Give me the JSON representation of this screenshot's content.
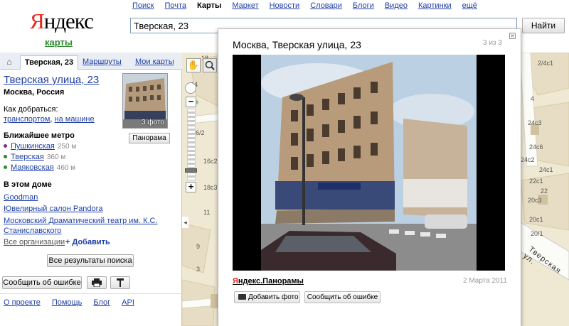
{
  "logo": {
    "first_letter": "Я",
    "rest": "ндекс",
    "service": "карты"
  },
  "topnav": [
    "Поиск",
    "Почта",
    "Карты",
    "Маркет",
    "Новости",
    "Словари",
    "Блоги",
    "Видео",
    "Картинки",
    "ещё"
  ],
  "topnav_active": "Карты",
  "search": {
    "value": "Тверская, 23",
    "button": "Найти"
  },
  "tabs": {
    "address": "Тверская, 23",
    "routes": "Маршруты",
    "my_maps": "Мои карты"
  },
  "place": {
    "title": "Тверская улица, 23",
    "subtitle": "Москва, Россия",
    "howto_label": "Как добраться:",
    "howto_transport": "транспортом",
    "howto_sep": ", ",
    "howto_car": "на машине",
    "photo_count": "3 фото",
    "panorama": "Панорама"
  },
  "metro": {
    "title": "Ближайшее метро",
    "stations": [
      {
        "name": "Пушкинская",
        "dist": "250 м",
        "color": "#8a2a8a"
      },
      {
        "name": "Тверская",
        "dist": "360 м",
        "color": "#2b8a2b"
      },
      {
        "name": "Маяковская",
        "dist": "460 м",
        "color": "#2b8a2b"
      }
    ]
  },
  "house": {
    "title": "В этом доме",
    "orgs": [
      "Goodman",
      "Ювелирный салон Pandora",
      "Московский Драматический театр им. К.С. Станиславского"
    ],
    "all_orgs": "Все организации",
    "add": "+ Добавить"
  },
  "actions": {
    "all_results": "Все результаты поиска",
    "report_error": "Сообщить об ошибке"
  },
  "footer": [
    "О проекте",
    "Помощь",
    "Блог",
    "API"
  ],
  "map_labels": [
    "18",
    "24с3",
    "24с6",
    "24с2",
    "24с1",
    "22с1",
    "22",
    "20с3",
    "20с1",
    "20/1",
    "14",
    "16с2",
    "18с3",
    "11",
    "9",
    "3",
    "2/4с1",
    "4",
    "16/2"
  ],
  "map_street": "Тверская ул.",
  "popup": {
    "title": "Москва, Тверская улица, 23",
    "counter": "3 из 3",
    "brand_first": "Я",
    "brand_rest": "ндекс.Панорамы",
    "date": "2 Марта 2011",
    "add_photo": "Добавить фото",
    "report": "Сообщить об ошибке",
    "close": "×"
  },
  "colors": {
    "link": "#1f3fa6",
    "yandex_red": "#e8261a",
    "service_green": "#2a8a2a"
  }
}
